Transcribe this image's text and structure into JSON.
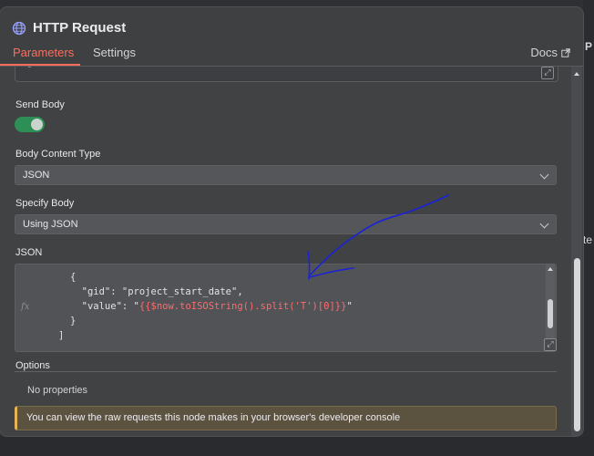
{
  "app": {
    "title": "HTTP Request",
    "tabs": [
      {
        "label": "Parameters",
        "active": true
      },
      {
        "label": "Settings",
        "active": false
      }
    ],
    "docs_label": "Docs",
    "accent_color": "#ff6d5a"
  },
  "background": {
    "edge_text_top": "P",
    "edge_text_mid": "te"
  },
  "form": {
    "send_body": {
      "label": "Send Body",
      "enabled": true
    },
    "body_content_type": {
      "label": "Body Content Type",
      "value": "JSON"
    },
    "specify_body": {
      "label": "Specify Body",
      "value": "Using JSON"
    },
    "json": {
      "label": "JSON",
      "fx_label": "fx",
      "lines": [
        {
          "text": "{"
        },
        {
          "text": "  \"gid\": \"project_start_date\","
        },
        {
          "prefix": "  \"value\": ",
          "quote_open": "\"",
          "expression": "{{$now.toISOString().split('T')[0]}}",
          "quote_close": "\""
        },
        {
          "text": "}"
        },
        {
          "text": "]"
        }
      ]
    },
    "options": {
      "label": "Options",
      "empty_text": "No properties"
    },
    "notice": {
      "text": "You can view the raw requests this node makes in your browser's developer console",
      "color": "#e6b457"
    }
  },
  "annotation": {
    "color": "#1a23d6"
  }
}
